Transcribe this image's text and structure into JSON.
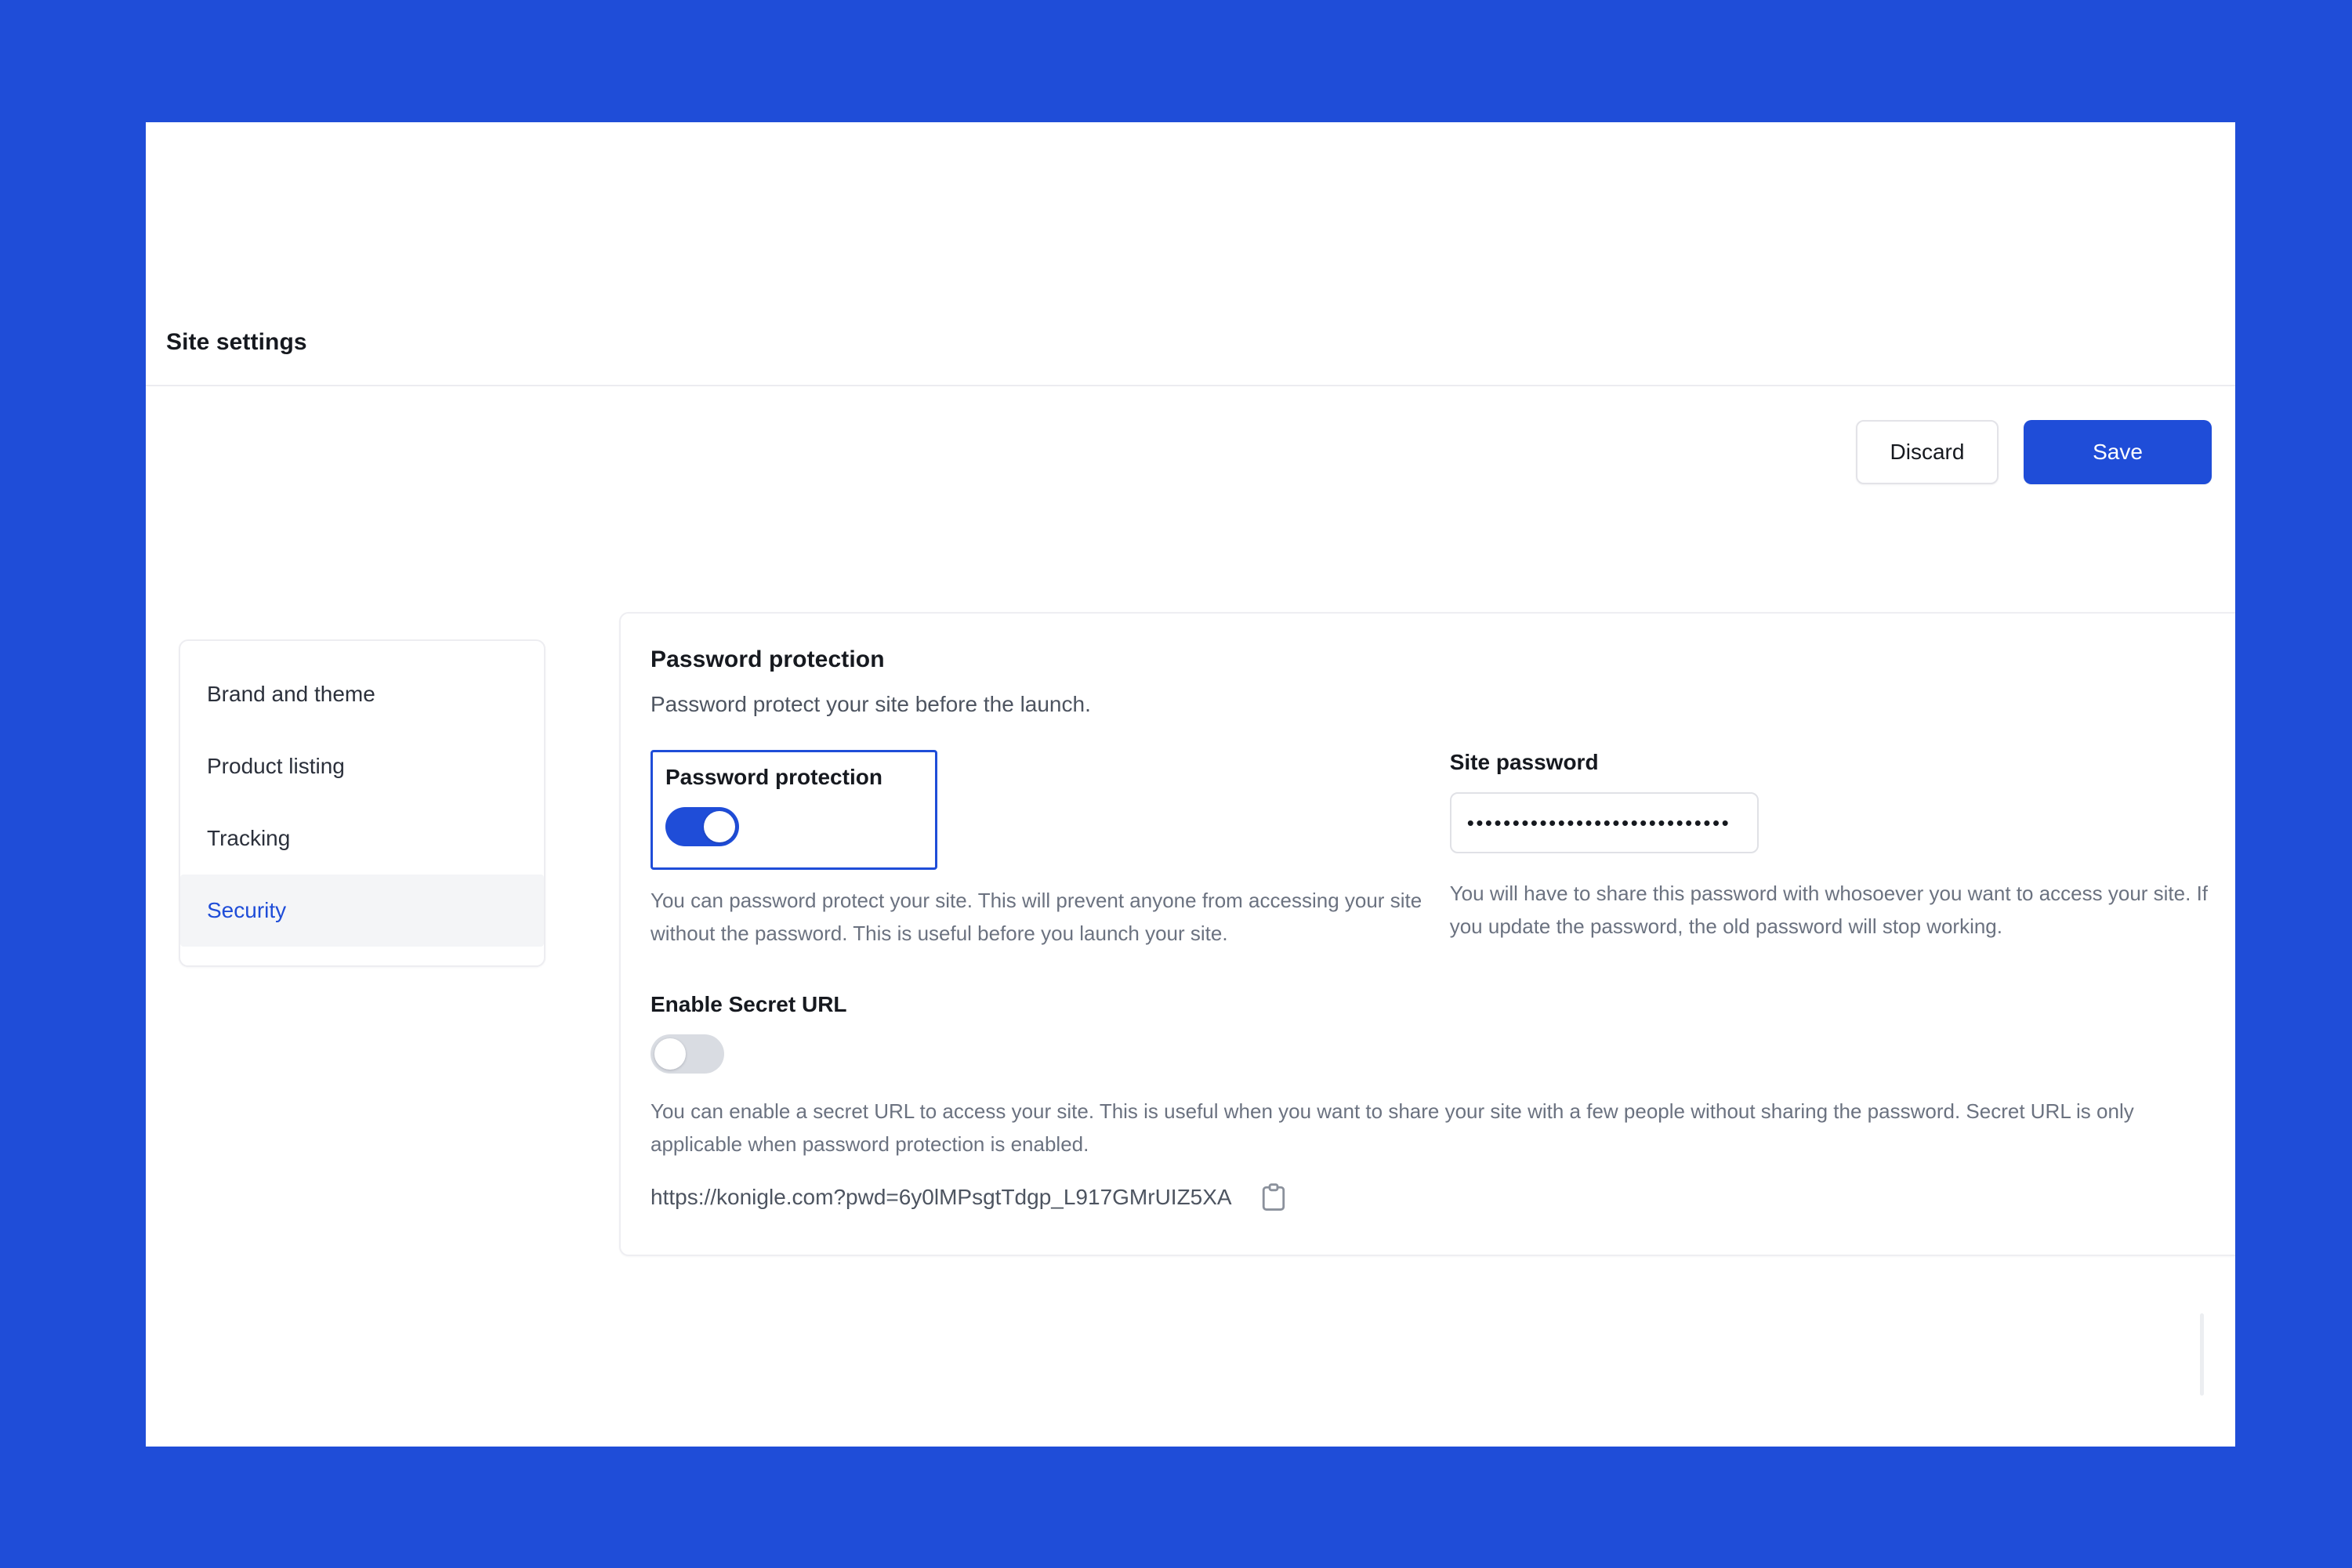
{
  "window": {
    "title": "Site settings"
  },
  "toolbar": {
    "discard_label": "Discard",
    "save_label": "Save"
  },
  "sidebar": {
    "items": [
      {
        "label": "Brand and theme",
        "active": false
      },
      {
        "label": "Product listing",
        "active": false
      },
      {
        "label": "Tracking",
        "active": false
      },
      {
        "label": "Security",
        "active": true
      }
    ]
  },
  "main": {
    "section_title": "Password protection",
    "section_subtitle": "Password protect your site before the launch.",
    "password_protection": {
      "label": "Password protection",
      "enabled": true,
      "help": "You can password protect your site. This will prevent anyone from accessing your site without the password. This is useful before you launch your site."
    },
    "site_password": {
      "label": "Site password",
      "value": "•••••••••••••••••••••••••••••",
      "help": "You will have to share this password with whosoever you want to access your site. If you update the password, the old password will stop working."
    },
    "secret_url": {
      "label": "Enable Secret URL",
      "enabled": false,
      "help": "You can enable a secret URL to access your site. This is useful when you want to share your site with a few people without sharing the password. Secret URL is only applicable when password protection is enabled.",
      "url": "https://konigle.com?pwd=6y0lMPsgtTdgp_L917GMrUIZ5XA",
      "copy_icon": "clipboard-icon"
    }
  },
  "colors": {
    "background_blue": "#1f4dd8",
    "accent_blue": "#1f4dd8",
    "toggle_off": "#d9dce2",
    "card_border": "#eeeef2"
  }
}
